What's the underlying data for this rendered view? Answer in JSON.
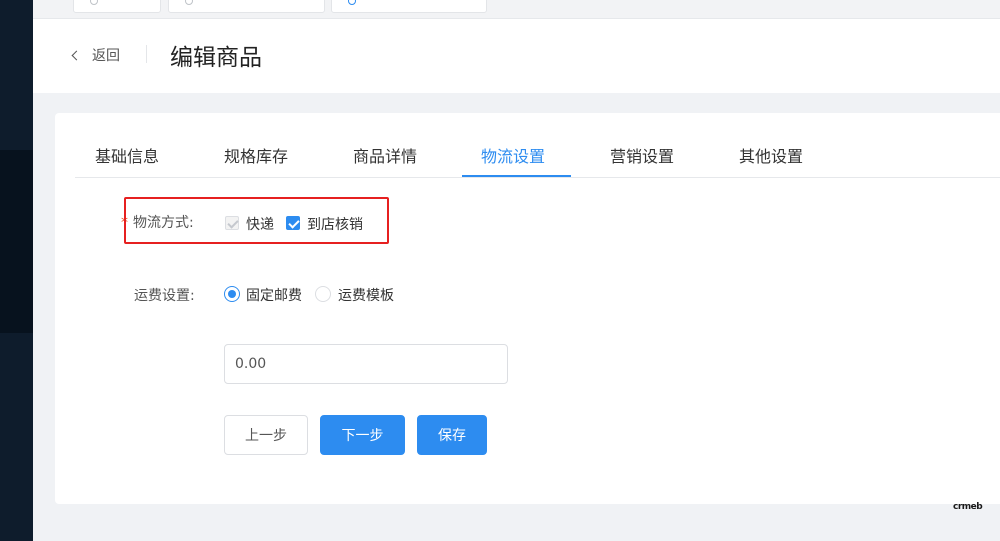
{
  "header": {
    "back_label": "返回",
    "title": "编辑商品"
  },
  "tabs": [
    {
      "label": "基础信息",
      "active": false
    },
    {
      "label": "规格库存",
      "active": false
    },
    {
      "label": "商品详情",
      "active": false
    },
    {
      "label": "物流设置",
      "active": true
    },
    {
      "label": "营销设置",
      "active": false
    },
    {
      "label": "其他设置",
      "active": false
    }
  ],
  "form": {
    "logistics": {
      "label": "物流方式:",
      "required_mark": "*",
      "options": [
        {
          "label": "快递",
          "checked": true,
          "disabled": true
        },
        {
          "label": "到店核销",
          "checked": true,
          "disabled": false
        }
      ]
    },
    "freight": {
      "label": "运费设置:",
      "options": [
        {
          "label": "固定邮费",
          "selected": true
        },
        {
          "label": "运费模板",
          "selected": false
        }
      ],
      "fee_value": "0.00"
    }
  },
  "buttons": {
    "prev": "上一步",
    "next": "下一步",
    "save": "保存"
  },
  "logo_text": "crmeb",
  "colors": {
    "primary": "#2d8cf0",
    "highlight": "#e62020",
    "sidebar": "#0e1c2c"
  }
}
